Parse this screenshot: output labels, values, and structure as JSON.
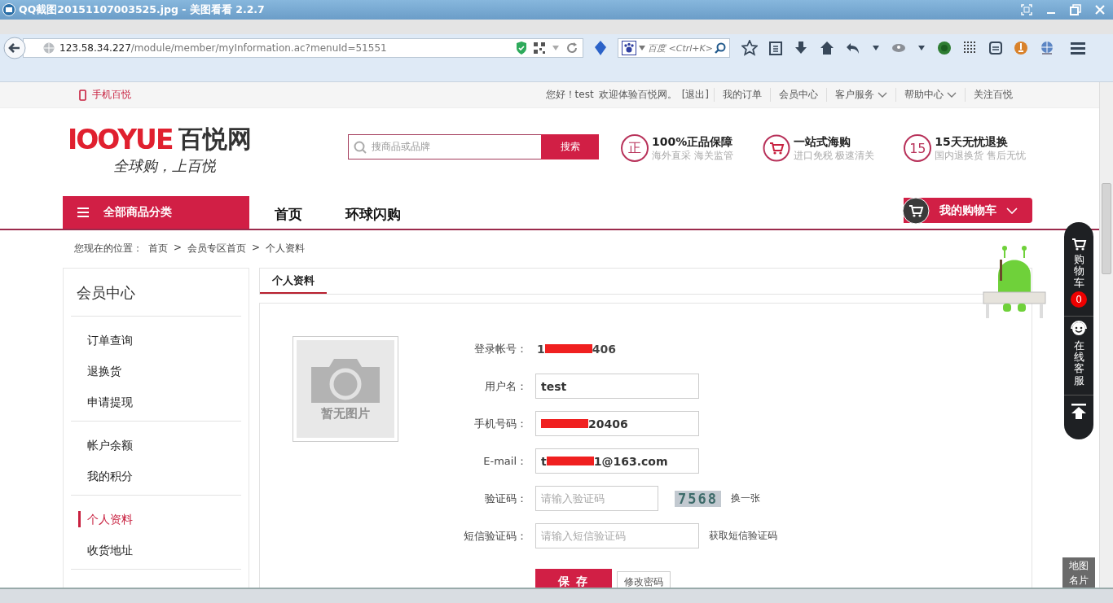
{
  "window": {
    "title": "QQ截图20151107003525.jpg - 美图看看 2.2.7"
  },
  "browser": {
    "url_host": "123.58.34.227",
    "url_path": "/module/member/myInformation.ac?menuId=51551",
    "search_placeholder": "百度 <Ctrl+K>"
  },
  "topbar": {
    "mobile": "手机百悦",
    "greeting": "您好！test",
    "welcome": "欢迎体验百悦网。",
    "logout": "[退出]",
    "links": [
      {
        "label": "我的订单",
        "dropdown": false
      },
      {
        "label": "会员中心",
        "dropdown": false
      },
      {
        "label": "客户服务",
        "dropdown": true
      },
      {
        "label": "帮助中心",
        "dropdown": true
      },
      {
        "label": "关注百悦",
        "dropdown": false
      }
    ]
  },
  "header": {
    "logo_latin": "IOOYUE",
    "logo_cn": "百悦网",
    "slogan": "全球购，上百悦",
    "search_placeholder": "搜商品或品牌",
    "search_button": "搜索",
    "features": [
      {
        "kind": "text",
        "icon": "正",
        "title": "100%正品保障",
        "subtitle": "海外直采 海关监管"
      },
      {
        "kind": "cart",
        "title": "一站式海购",
        "subtitle": "进口免税 极速清关"
      },
      {
        "kind": "text",
        "icon": "15",
        "title": "15天无忧退换",
        "subtitle": "国内退换货 售后无忧"
      }
    ]
  },
  "nav": {
    "categories": "全部商品分类",
    "items": [
      {
        "label": "首页",
        "selected": false
      },
      {
        "label": "环球闪购",
        "selected": false
      }
    ],
    "cart": "我的购物车"
  },
  "breadcrumb": {
    "label": "您现在的位置：",
    "separator": ">",
    "items": [
      "首页",
      "会员专区首页",
      "个人资料"
    ]
  },
  "sidebar": {
    "title": "会员中心",
    "groups": [
      [
        {
          "label": "订单查询",
          "selected": false
        },
        {
          "label": "退换货",
          "selected": false
        },
        {
          "label": "申请提现",
          "selected": false
        }
      ],
      [
        {
          "label": "帐户余额",
          "selected": false
        },
        {
          "label": "我的积分",
          "selected": false
        }
      ],
      [
        {
          "label": "个人资料",
          "selected": true
        },
        {
          "label": "收货地址",
          "selected": false
        }
      ]
    ]
  },
  "profile": {
    "tab": "个人资料",
    "avatar_text": "暂无图片",
    "fields": [
      {
        "kind": "static",
        "label": "登录帐号：",
        "prefix": "1",
        "value": "406",
        "redacted": true
      },
      {
        "kind": "input",
        "label": "用户名：",
        "value": "test",
        "redacted": false
      },
      {
        "kind": "input",
        "label": "手机号码：",
        "value": "20406",
        "redacted": true
      },
      {
        "kind": "input",
        "label": "E-mail：",
        "prefix": "t",
        "value": "1@163.com",
        "redacted": true
      },
      {
        "kind": "captcha",
        "label": "验证码：",
        "placeholder": "请输入验证码",
        "captcha": "7568",
        "action": "换一张"
      },
      {
        "kind": "sms",
        "label": "短信验证码：",
        "placeholder": "请输入短信验证码",
        "action": "获取短信验证码"
      }
    ],
    "save": "保 存",
    "change_password": "修改密码"
  },
  "dock": [
    {
      "kind": "cart",
      "label": "购物车",
      "count": "0"
    },
    {
      "kind": "service",
      "label": "在线客服"
    },
    {
      "kind": "top"
    }
  ],
  "map_card": "地图名片"
}
